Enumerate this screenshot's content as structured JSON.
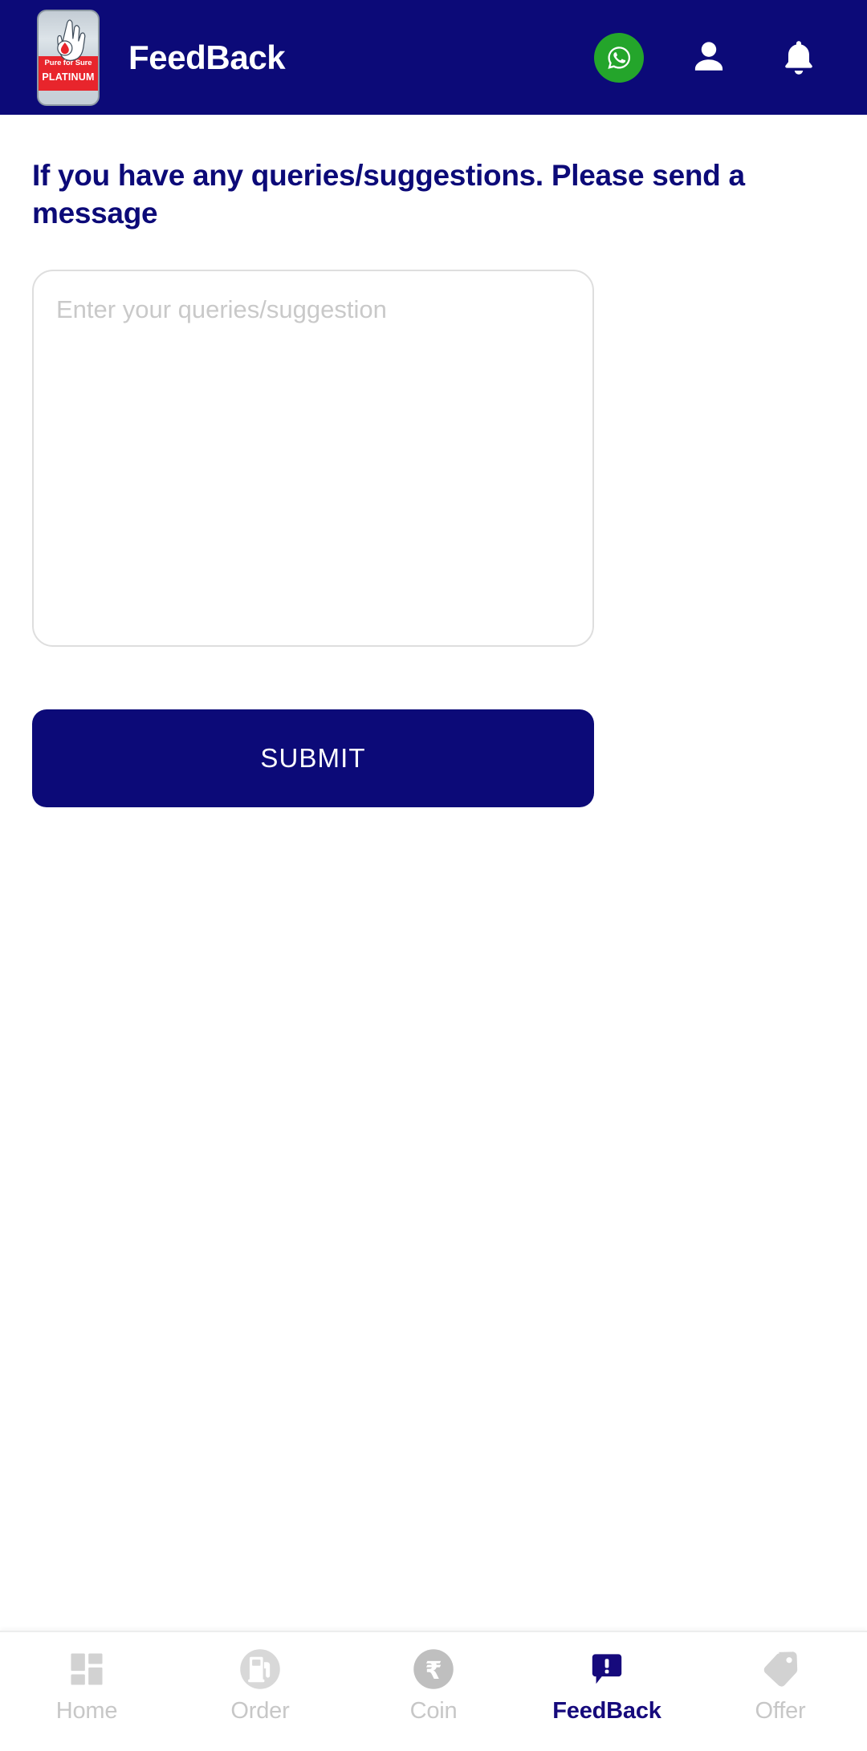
{
  "theme": {
    "primary_navy": "#0c0a78",
    "whatsapp_green": "#24a52b",
    "inactive_gray": "#c7c7c7",
    "border_gray": "#dedede",
    "logo_red": "#e8252c"
  },
  "header": {
    "title": "FeedBack",
    "logo": {
      "icon": "pure-for-sure-platinum-badge",
      "line1": "Pure for Sure",
      "line2": "PLATINUM"
    },
    "actions": [
      {
        "name": "whatsapp-button",
        "icon": "whatsapp-icon"
      },
      {
        "name": "profile-button",
        "icon": "person-icon"
      },
      {
        "name": "notifications-button",
        "icon": "bell-icon"
      }
    ]
  },
  "main": {
    "headline": "If you have any queries/suggestions. Please send a message",
    "feedback_input": {
      "placeholder": "Enter your queries/suggestion",
      "value": ""
    },
    "submit_label": "SUBMIT"
  },
  "bottom_nav": {
    "active_index": 3,
    "items": [
      {
        "label": "Home",
        "icon": "dashboard-grid-icon"
      },
      {
        "label": "Order",
        "icon": "fuel-pump-circle-icon"
      },
      {
        "label": "Coin",
        "icon": "rupee-coin-icon"
      },
      {
        "label": "FeedBack",
        "icon": "speech-bubble-alert-icon"
      },
      {
        "label": "Offer",
        "icon": "price-tag-icon"
      }
    ]
  }
}
